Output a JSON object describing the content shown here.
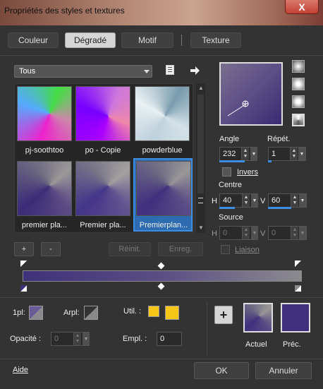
{
  "window": {
    "title": "Propriétés des styles et textures",
    "close_label": "X"
  },
  "tabs": [
    {
      "label": "Couleur"
    },
    {
      "label": "Dégradé",
      "active": true
    },
    {
      "label": "Motif"
    },
    {
      "label": "Texture"
    }
  ],
  "browser": {
    "category": "Tous",
    "items": [
      {
        "label": "pj-soothtoo"
      },
      {
        "label": "po - Copie"
      },
      {
        "label": "powderblue"
      },
      {
        "label": "premier pla..."
      },
      {
        "label": "Premier pla..."
      },
      {
        "label": "Premierplan...",
        "selected": true
      }
    ],
    "add_label": "+",
    "remove_label": "-",
    "reset_label": "Réinit.",
    "save_label": "Enreg."
  },
  "gradient": {
    "angle_label": "Angle",
    "angle": "232",
    "repeat_label": "Répét.",
    "repeat": "1",
    "invert_label": "Invers",
    "center_label": "Centre",
    "center_h_label": "H",
    "center_h": "40",
    "center_v_label": "V",
    "center_v": "60",
    "source_label": "Source",
    "source_h_label": "H",
    "source_h": "0",
    "source_v_label": "V",
    "source_v": "0",
    "link_label": "Liaison"
  },
  "editor": {
    "fg_label": "1pl:",
    "bg_label": "Arpl:",
    "user_label": "Util. :",
    "opacity_label": "Opacité :",
    "opacity": "0",
    "location_label": "Empl. :",
    "location": "0",
    "user_color": "#f5c518"
  },
  "compare": {
    "current_label": "Actuel",
    "previous_label": "Préc."
  },
  "footer": {
    "help_label": "Aide",
    "ok_label": "OK",
    "cancel_label": "Annuler"
  }
}
